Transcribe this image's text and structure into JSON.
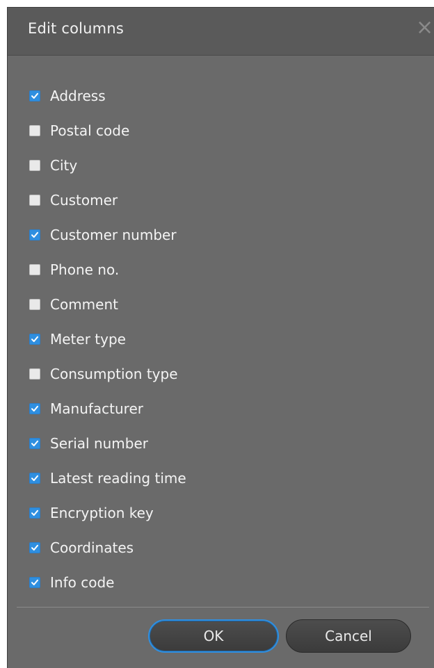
{
  "dialog": {
    "title": "Edit columns",
    "close_glyph": "×",
    "columns": [
      {
        "label": "Address",
        "checked": true
      },
      {
        "label": "Postal code",
        "checked": false
      },
      {
        "label": "City",
        "checked": false
      },
      {
        "label": "Customer",
        "checked": false
      },
      {
        "label": "Customer number",
        "checked": true
      },
      {
        "label": "Phone no.",
        "checked": false
      },
      {
        "label": "Comment",
        "checked": false
      },
      {
        "label": "Meter type",
        "checked": true
      },
      {
        "label": "Consumption type",
        "checked": false
      },
      {
        "label": "Manufacturer",
        "checked": true
      },
      {
        "label": "Serial number",
        "checked": true
      },
      {
        "label": "Latest reading time",
        "checked": true
      },
      {
        "label": "Encryption key",
        "checked": true
      },
      {
        "label": "Coordinates",
        "checked": true
      },
      {
        "label": "Info code",
        "checked": true
      }
    ],
    "ok_label": "OK",
    "cancel_label": "Cancel"
  },
  "colors": {
    "background": "#6a6a6a",
    "checkbox_checked": "#2f8fe0",
    "checkbox_unchecked": "#e9e9e9",
    "text": "#f4f4f4"
  }
}
